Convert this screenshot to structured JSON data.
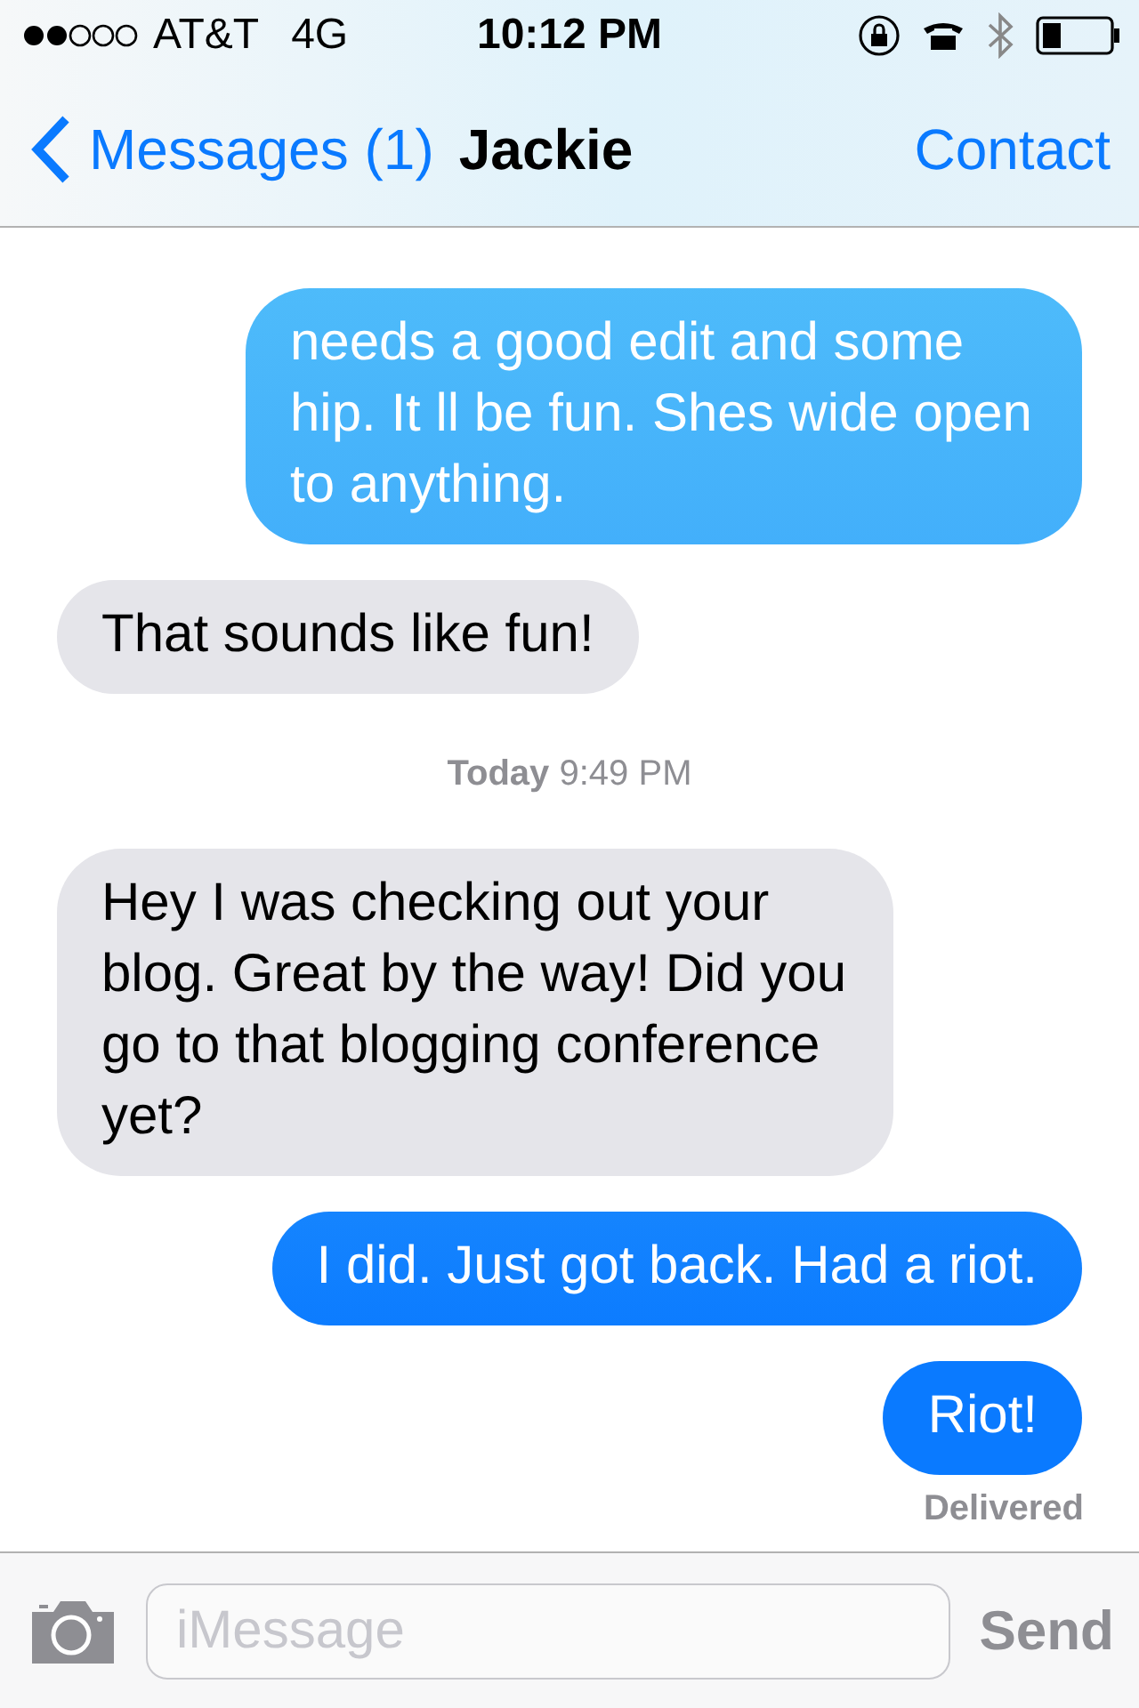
{
  "status_bar": {
    "carrier": "AT&T",
    "network": "4G",
    "time": "10:12 PM"
  },
  "nav_bar": {
    "back_label": "Messages (1)",
    "title": "Jackie",
    "action": "Contact"
  },
  "messages": [
    {
      "kind": "sent",
      "text": "needs a good edit and some hip. It ll be fun. Shes wide open to anything."
    },
    {
      "kind": "received",
      "text": "That sounds like fun!"
    },
    {
      "kind": "timestamp",
      "label": "Today",
      "time": "9:49 PM"
    },
    {
      "kind": "received",
      "text": "Hey I was checking out your blog. Great by the way! Did you go to that blogging conference yet?"
    },
    {
      "kind": "sent",
      "text": "I did. Just got back. Had a riot."
    },
    {
      "kind": "sent",
      "text": "Riot!"
    },
    {
      "kind": "status",
      "text": "Delivered"
    }
  ],
  "input_bar": {
    "placeholder": "iMessage",
    "send": "Send"
  }
}
